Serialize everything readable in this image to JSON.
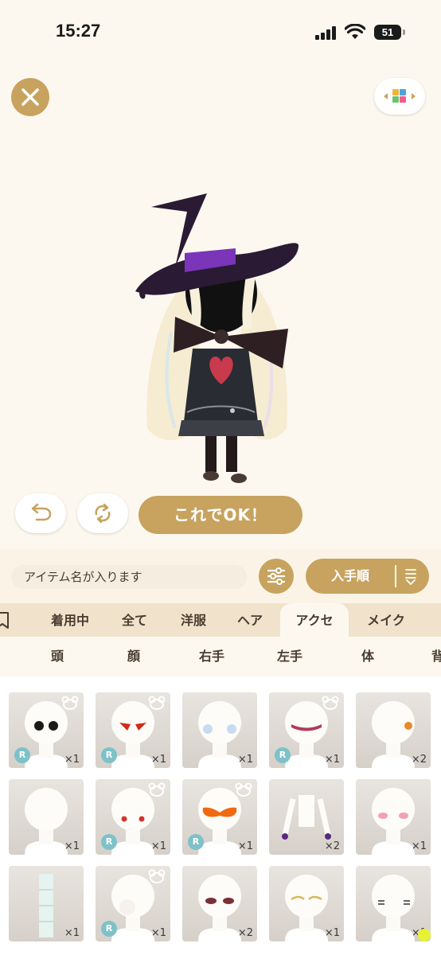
{
  "status_bar": {
    "time": "15:27",
    "battery": "51"
  },
  "main_button": "これでOK！",
  "search": {
    "placeholder": "アイテム名が入ります"
  },
  "sort": {
    "label": "入手順"
  },
  "colors": {
    "gold": "#c7a35f",
    "badge_r": "#7ec1c9",
    "tab_bg": "#f1e3cb"
  },
  "category_tabs": [
    {
      "label": "着用中"
    },
    {
      "label": "全て"
    },
    {
      "label": "洋服"
    },
    {
      "label": "ヘア"
    },
    {
      "label": "アクセ",
      "active": true
    },
    {
      "label": "メイク"
    }
  ],
  "sub_tabs": [
    {
      "label": "頭"
    },
    {
      "label": "顔"
    },
    {
      "label": "右手"
    },
    {
      "label": "左手"
    },
    {
      "label": "体"
    },
    {
      "label": "背"
    }
  ],
  "items": [
    {
      "icon": "black-eyes-icon",
      "rare": "R",
      "bear": true,
      "qty": "×1"
    },
    {
      "icon": "red-eyes-icon",
      "rare": "R",
      "bear": true,
      "qty": "×1"
    },
    {
      "icon": "blue-cheek-icon",
      "rare": "",
      "bear": false,
      "qty": "×1"
    },
    {
      "icon": "red-eyeshadow-icon",
      "rare": "R",
      "bear": true,
      "qty": "×1"
    },
    {
      "icon": "pumpkin-icon",
      "rare": "",
      "bear": false,
      "qty": "×2"
    },
    {
      "icon": "blank-head-icon",
      "rare": "",
      "bear": false,
      "qty": "×1"
    },
    {
      "icon": "red-dots-icon",
      "rare": "R",
      "bear": true,
      "qty": "×1"
    },
    {
      "icon": "orange-mask-icon",
      "rare": "R",
      "bear": true,
      "qty": "×1"
    },
    {
      "icon": "body-gloves-icon",
      "rare": "",
      "bear": false,
      "qty": "×2"
    },
    {
      "icon": "pink-blush-icon",
      "rare": "",
      "bear": false,
      "qty": "×1"
    },
    {
      "icon": "body-plaid-icon",
      "rare": "",
      "bear": false,
      "qty": "×1"
    },
    {
      "icon": "white-bubble-icon",
      "rare": "R",
      "bear": true,
      "qty": "×1"
    },
    {
      "icon": "dark-eyeshadow-icon",
      "rare": "",
      "bear": false,
      "qty": "×2"
    },
    {
      "icon": "gold-lashes-icon",
      "rare": "",
      "bear": false,
      "qty": "×1"
    },
    {
      "icon": "smile-eyes-icon",
      "rare": "",
      "bear": false,
      "qty": "×1"
    }
  ]
}
